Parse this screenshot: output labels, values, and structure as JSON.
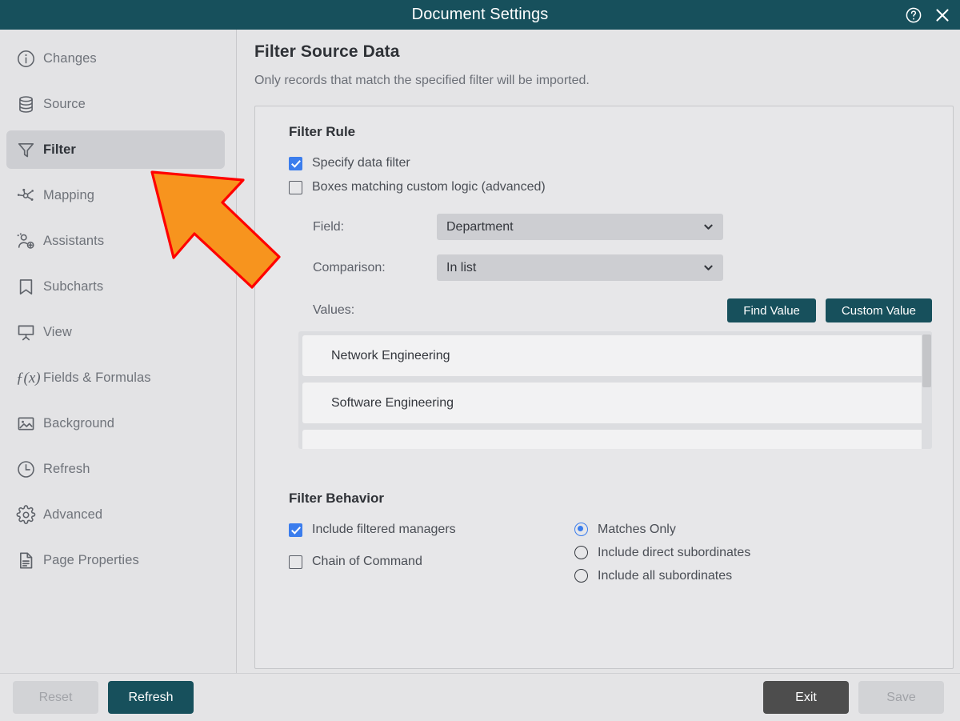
{
  "window": {
    "title": "Document Settings",
    "help_icon": "help-circle-icon",
    "close_icon": "close-icon"
  },
  "sidebar": {
    "items": [
      {
        "label": "Changes",
        "icon": "info-circle-icon",
        "active": false
      },
      {
        "label": "Source",
        "icon": "database-icon",
        "active": false
      },
      {
        "label": "Filter",
        "icon": "funnel-icon",
        "active": true
      },
      {
        "label": "Mapping",
        "icon": "nodes-icon",
        "active": false
      },
      {
        "label": "Assistants",
        "icon": "user-add-icon",
        "active": false
      },
      {
        "label": "Subcharts",
        "icon": "bookmark-icon",
        "active": false
      },
      {
        "label": "View",
        "icon": "presentation-icon",
        "active": false
      },
      {
        "label": "Fields & Formulas",
        "icon": "function-icon",
        "active": false
      },
      {
        "label": "Background",
        "icon": "image-icon",
        "active": false
      },
      {
        "label": "Refresh",
        "icon": "clock-icon",
        "active": false
      },
      {
        "label": "Advanced",
        "icon": "gear-icon",
        "active": false
      },
      {
        "label": "Page Properties",
        "icon": "document-icon",
        "active": false
      }
    ]
  },
  "main": {
    "page_title": "Filter Source Data",
    "page_subtitle": "Only records that match the specified filter will be imported.",
    "filter_rule": {
      "section_title": "Filter Rule",
      "specify_data_filter": {
        "label": "Specify data filter",
        "checked": true
      },
      "custom_logic": {
        "label": "Boxes matching custom logic (advanced)",
        "checked": false
      },
      "field": {
        "label": "Field:",
        "value": "Department"
      },
      "comparison": {
        "label": "Comparison:",
        "value": "In list"
      },
      "values": {
        "label": "Values:",
        "find_value_button": "Find Value",
        "custom_value_button": "Custom Value",
        "items": [
          "Network Engineering",
          "Software Engineering",
          ""
        ]
      }
    },
    "filter_behavior": {
      "section_title": "Filter Behavior",
      "include_filtered_managers": {
        "label": "Include filtered managers",
        "checked": true
      },
      "chain_of_command": {
        "label": "Chain of Command",
        "checked": false
      },
      "scope_options": [
        {
          "label": "Matches Only",
          "selected": true
        },
        {
          "label": "Include direct subordinates",
          "selected": false
        },
        {
          "label": "Include all subordinates",
          "selected": false
        }
      ]
    }
  },
  "footer": {
    "reset_label": "Reset",
    "refresh_label": "Refresh",
    "exit_label": "Exit",
    "save_label": "Save"
  },
  "annotation": {
    "arrow_icon": "pointer-arrow-icon",
    "fill_color": "#F7941E",
    "stroke_color": "#FF0000"
  },
  "colors": {
    "titlebar": "#17505C",
    "accent_teal": "#17505C",
    "checkbox_blue": "#3B7DED",
    "sidebar_bg": "#E3E3E5",
    "panel_bg": "#E7E7E9"
  }
}
